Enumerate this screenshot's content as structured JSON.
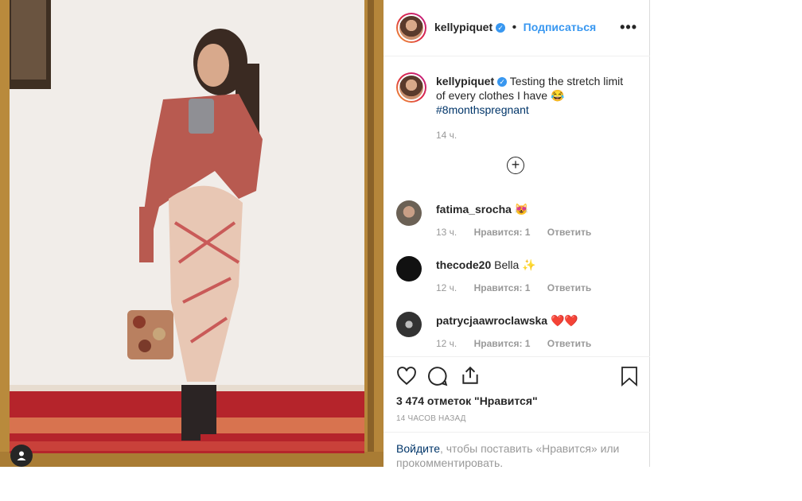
{
  "post": {
    "username": "kellypiquet",
    "follow_label": "Подписаться",
    "caption_text": "Testing the stretch limit of every clothes I have 😂",
    "hashtag": "#8monthspregnant",
    "caption_time": "14 ч.",
    "likes": "3 474 отметок \"Нравится\"",
    "posted_ago": "14 ЧАСОВ НАЗАД"
  },
  "comments": [
    {
      "username": "fatima_srocha",
      "text": "😻",
      "time": "13 ч.",
      "likes": "Нравится: 1",
      "reply": "Ответить"
    },
    {
      "username": "thecode20",
      "text": "Bella ✨",
      "time": "12 ч.",
      "likes": "Нравится: 1",
      "reply": "Ответить"
    },
    {
      "username": "patrycjaawroclawska",
      "text": "❤️❤️",
      "time": "12 ч.",
      "likes": "Нравится: 1",
      "reply": "Ответить"
    }
  ],
  "login_prompt": {
    "link": "Войдите",
    "rest": ", чтобы поставить «Нравится» или прокомментировать."
  },
  "icons": {
    "verified": "verified-badge-icon",
    "more": "more-options-icon",
    "load_more": "plus-circle-icon",
    "like": "heart-icon",
    "comment": "comment-icon",
    "share": "share-icon",
    "save": "bookmark-icon",
    "user_tag": "user-tag-icon"
  },
  "colors": {
    "accent": "#3897f0",
    "text": "#262626",
    "muted": "#999999",
    "hashtag": "#003569"
  }
}
